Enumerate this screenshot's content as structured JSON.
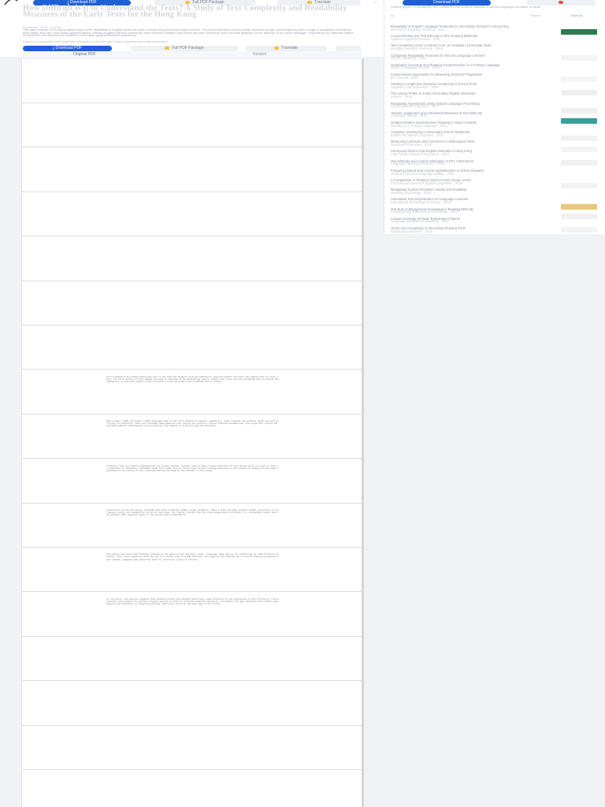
{
  "header": {
    "download_label": "Download PDF",
    "full_pdf_label": "Full PDF Package",
    "translate_label": "Translate",
    "more_label": "...",
    "title": "How Difficult is it to Understand the Texts? A Study of Text Complexity and Readability Measures of the Early Texts for the Hong Kong",
    "meta": "by Authors  ·  2016  ·  Journal",
    "abstract": "This paper reports on a corpus-based study of the readability of English textbooks used in Hong Kong junior secondary schools. The study examines lexical density, sentence length, word frequency and a range of readability formulas for texts drawn from the most widely adopted series. Results suggest that text complexity rises unevenly between year levels and that commonly used formulas disagree on the difficulty of the same passages. Implications for materials writers and teachers are discussed in relation to curriculum goals and learner proficiency.",
    "extra": "Keywords: readability, text complexity, textbooks, lexical density, corpus linguistics, secondary education"
  },
  "subbar": {
    "download_label": "Download PDF",
    "full_pdf_label": "Full PDF Package",
    "translate_label": "Translate"
  },
  "view_tabs": {
    "original": "Original PDF",
    "related": "Related"
  },
  "pages": [
    {
      "text": ""
    },
    {
      "text": ""
    },
    {
      "text": ""
    },
    {
      "text": ""
    },
    {
      "text": ""
    },
    {
      "text": ""
    },
    {
      "text": ""
    },
    {
      "text": "and it seemed to be trouble taking the test to see what the students would be expected to read and whether the texts were appropriate for their level. The first section of this chapter provides an overview of the methodology used to compile the corpus and the procedures used to analyse the readability of each text sample in the collection across the grade levels examined here in detail."
    },
    {
      "text": "Dale & Chall (1948) and Flesch (1948) developed some of the first formulas to measure readability. These formulas use sentence length and word difficulty as predictors. Later work extended these measures with lexical and syntactic indices computed automatically from large text corpora and validated against comprehension scores obtained from readers of different ages and abilities."
    },
    {
      "text": "vocabulary size and reading comprehension are closely related. Learners need to know a large proportion of the running words in a text in order to understand it adequately. Estimates range from ninety-five to ninety-eight percent coverage depending on the purpose of reading and the support available to the learner in the classroom setting described by the teachers in this study."
    },
    {
      "text": "consistently across the series, although some units contained notably longer sentences. Table 3 shows the mean sentence length, proportion of low frequency words, and readability scores for each book. The figures indicate that the step between Book 2 and Book 3 is considerably larger than that between other adjacent levels in the series under investigation."
    },
    {
      "text": "The results also show that different formulas do not agree on the ranking of texts. A passage rated easy by one formula may be rated difficult by another. This raises questions about the use of a single index to grade materials, and supports the combined use of several measures alongside expert teacher judgement when selecting texts for particular groups of learners."
    },
    {
      "text": "In conclusion, the analysis suggests that textbook writers and teachers should pay closer attention to the progression of text difficulty. Future research could examine how learners actually perform on texts of different measured complexity, and whether the gaps identified here affect comprehension and motivation in classroom settings. References follow on the next page of the article."
    },
    {
      "text": ""
    },
    {
      "text": ""
    },
    {
      "text": ""
    },
    {
      "text": ""
    }
  ],
  "related": {
    "download_label": "Download PDF",
    "header_text": "Related papers on readability, text complexity and textbook analysis in second language education contexts.",
    "tab_all": "All",
    "tab_papers": "Papers",
    "tab_more": "Show all",
    "items": [
      {
        "title": "Readability of English Language Textbooks for Secondary Schools in Hong Kong",
        "sub": "Journal of Language Teaching · 2014"
      },
      {
        "title": "Lexical Density and Text Difficulty in EFL Reading Materials",
        "sub": "Applied Linguistics Review · 2012"
      },
      {
        "title": "Text Complexity in the Common Core: An Analysis of Exemplar Texts",
        "sub": "Reading Research Quarterly · 2013"
      },
      {
        "title": "Comparing Readability Formulas for Second Language Learners",
        "sub": "TESOL Quarterly · 2011"
      },
      {
        "title": "Vocabulary Coverage and Reading Comprehension in a Foreign Language",
        "sub": "Modern Language Journal · 2010"
      },
      {
        "title": "Corpus-based Approaches to Measuring Textbook Progression",
        "sub": "ELT Journal · 2015"
      },
      {
        "title": "Sentence Length and Syntactic Complexity in School Texts",
        "sub": "Linguistics and Education · 2009"
      },
      {
        "title": "The Lexical Profile of Junior Secondary English Textbooks",
        "sub": "System · 2016"
      },
      {
        "title": "Readability Assessment Using Natural Language Processing",
        "sub": "Computational Linguistics · 2017"
      },
      {
        "title": "Teacher Judgement and Automated Measures of Text Difficulty",
        "sub": "Language Testing · 2013"
      },
      {
        "title": "Graded Readers and Extensive Reading in Asian Contexts",
        "sub": "Reading in a Foreign Language · 2011"
      },
      {
        "title": "Academic Vocabulary in Secondary School Textbooks",
        "sub": "English for Specific Purposes · 2014"
      },
      {
        "title": "Measuring Cohesion and Coherence in Educational Texts",
        "sub": "Discourse Processes · 2012"
      },
      {
        "title": "Curriculum Reform and English Materials in Hong Kong",
        "sub": "Asia Pacific Journal of Education · 2010"
      },
      {
        "title": "Text Difficulty and Learner Motivation in EFL Classrooms",
        "sub": "Language Teaching Research · 2015"
      },
      {
        "title": "Frequency Bands and Lexical Sophistication in School Readers",
        "sub": "Journal of Second Language Writing · 2013"
      },
      {
        "title": "A Comparison of Textbook Series Across Grade Levels",
        "sub": "International Journal of Applied Linguistics · 2016"
      },
      {
        "title": "Readability Indices Revisited: Validity and Reliability",
        "sub": "Reading Psychology · 2018"
      },
      {
        "title": "Automated Text Simplification for Language Learners",
        "sub": "Educational Technology & Society · 2019"
      },
      {
        "title": "The Role of Background Knowledge in Reading Difficulty",
        "sub": "Contemporary Educational Psychology · 2012"
      },
      {
        "title": "Lexical Coverage of Public Examination Papers",
        "sub": "Language Assessment Quarterly · 2017"
      },
      {
        "title": "Genre and Complexity in Secondary Reading Texts",
        "sub": "Functional Linguistics · 2018"
      }
    ]
  },
  "colors": {
    "accent_blue": "#1f5fd6",
    "accent_yellow": "#f2c23a",
    "thumb_green": "#2f7a4f",
    "thumb_teal": "#3a9e9a",
    "thumb_tan": "#e7c77a"
  }
}
